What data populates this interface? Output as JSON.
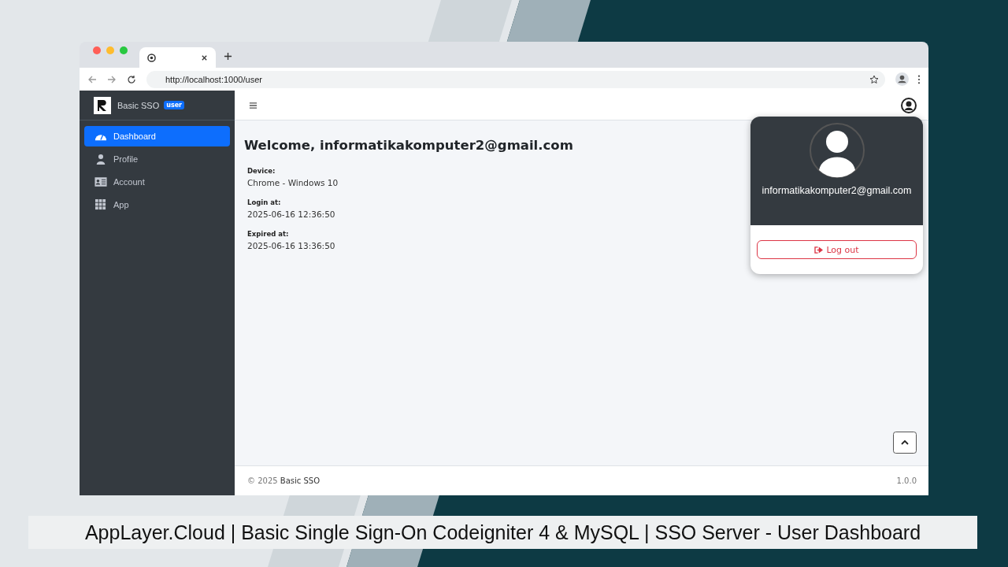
{
  "browser": {
    "url": "http://localhost:1000/user"
  },
  "sidebar": {
    "brand": "Basic SSO",
    "badge": "user",
    "items": [
      {
        "label": "Dashboard",
        "selected": true
      },
      {
        "label": "Profile",
        "selected": false
      },
      {
        "label": "Account",
        "selected": false
      },
      {
        "label": "App",
        "selected": false
      }
    ]
  },
  "content": {
    "heading": "Welcome, informatikakomputer2@gmail.com",
    "fields": [
      {
        "label": "Device:",
        "value": "Chrome - Windows 10"
      },
      {
        "label": "Login at:",
        "value": "2025-06-16 12:36:50"
      },
      {
        "label": "Expired at:",
        "value": "2025-06-16 13:36:50"
      }
    ]
  },
  "user_menu": {
    "email": "informatikakomputer2@gmail.com",
    "logout": "Log out"
  },
  "footer": {
    "copyright": "© 2025",
    "brand": "Basic SSO",
    "version": "1.0.0"
  },
  "caption": "AppLayer.Cloud | Basic Single Sign-On Codeigniter 4 & MySQL | SSO Server - User Dashboard"
}
